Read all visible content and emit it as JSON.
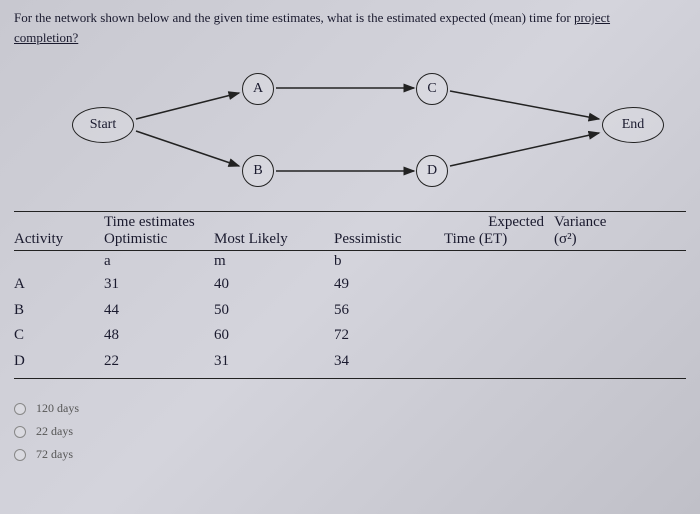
{
  "question": {
    "prefix": "For the network shown below and the given time estimates, what is the estimated expected (mean) time for ",
    "underlined1": "project",
    "underlined2": "completion?"
  },
  "nodes": {
    "start": "Start",
    "a": "A",
    "b": "B",
    "c": "C",
    "d": "D",
    "end": "End"
  },
  "headers": {
    "time_estimates": "Time estimates",
    "expected": "Expected",
    "variance": "Variance",
    "activity": "Activity",
    "optimistic": "Optimistic",
    "most_likely": "Most Likely",
    "pessimistic": "Pessimistic",
    "time_et": "Time (ET)",
    "sigma": "(σ²)",
    "a": "a",
    "m": "m",
    "b": "b"
  },
  "rows": [
    {
      "act": "A",
      "a": "31",
      "m": "40",
      "b": "49"
    },
    {
      "act": "B",
      "a": "44",
      "m": "50",
      "b": "56"
    },
    {
      "act": "C",
      "a": "48",
      "m": "60",
      "b": "72"
    },
    {
      "act": "D",
      "a": "22",
      "m": "31",
      "b": "34"
    }
  ],
  "options": [
    "120 days",
    "22 days",
    "72 days"
  ]
}
